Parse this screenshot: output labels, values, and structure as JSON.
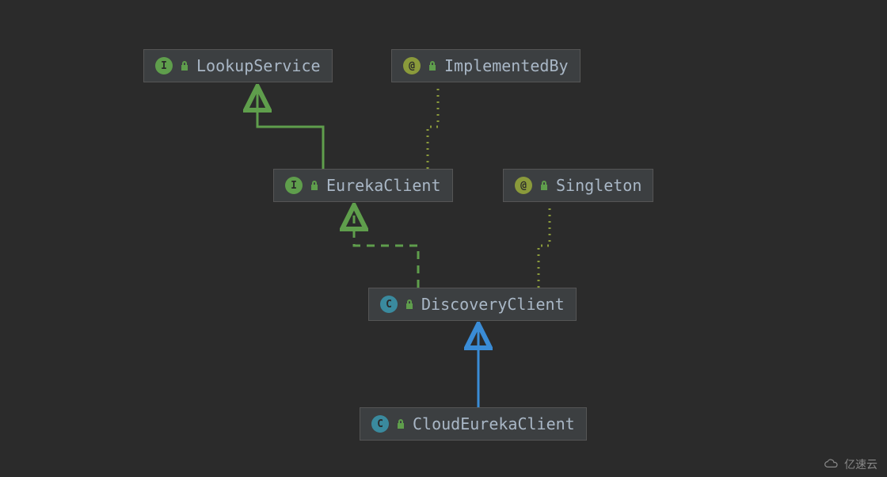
{
  "nodes": {
    "lookup": {
      "badge": "I",
      "label": "LookupService"
    },
    "implby": {
      "badge": "@",
      "label": "ImplementedBy"
    },
    "eureka": {
      "badge": "I",
      "label": "EurekaClient"
    },
    "singleton": {
      "badge": "@",
      "label": "Singleton"
    },
    "discovery": {
      "badge": "C",
      "label": "DiscoveryClient"
    },
    "cloud": {
      "badge": "C",
      "label": "CloudEurekaClient"
    }
  },
  "watermark": "亿速云",
  "colors": {
    "extends_solid": "#5f9e4c",
    "implements_dashed": "#5f9e4c",
    "annotation_dotted": "#8a9a3b",
    "class_extends": "#3a8cd6"
  },
  "diagram_meta": {
    "description": "UML class hierarchy: CloudEurekaClient extends DiscoveryClient; DiscoveryClient implements EurekaClient and is annotated @Singleton; EurekaClient extends LookupService and is annotated @ImplementedBy.",
    "relations": [
      {
        "from": "CloudEurekaClient",
        "to": "DiscoveryClient",
        "kind": "extends",
        "style": "solid-blue"
      },
      {
        "from": "DiscoveryClient",
        "to": "EurekaClient",
        "kind": "implements",
        "style": "dashed-green"
      },
      {
        "from": "DiscoveryClient",
        "to": "Singleton",
        "kind": "annotation",
        "style": "dotted-olive"
      },
      {
        "from": "EurekaClient",
        "to": "LookupService",
        "kind": "extends",
        "style": "solid-green"
      },
      {
        "from": "EurekaClient",
        "to": "ImplementedBy",
        "kind": "annotation",
        "style": "dotted-olive"
      }
    ]
  }
}
